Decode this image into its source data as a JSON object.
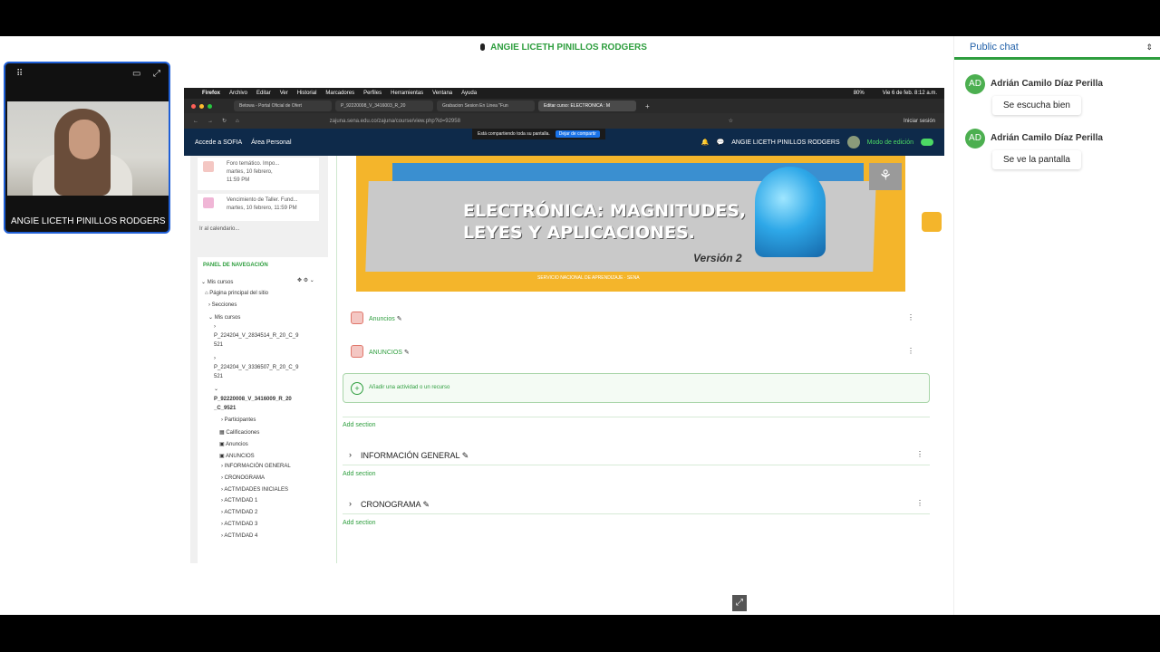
{
  "speaker": {
    "name": "ANGIE LICETH PINILLOS RODGERS"
  },
  "webcam": {
    "name": "ANGIE LICETH PINILLOS RODGERS"
  },
  "browser": {
    "menu": [
      "Firefox",
      "Archivo",
      "Editar",
      "Ver",
      "Historial",
      "Marcadores",
      "Perfiles",
      "Herramientas",
      "Ventana",
      "Ayuda"
    ],
    "clock": "Vie 6 de feb. 8:12 a.m.",
    "battery": "80%",
    "tabs": [
      "Betowa - Portal Oficial de Ofert",
      "P_92220008_V_3416003_R_20",
      "Grabacion Sesion En Linea \"Fun",
      "Editar curso: ELECTRONICA : M"
    ],
    "url": "zajuna.sena.edu.co/zajuna/course/view.php?id=92958",
    "login": "Iniciar sesión",
    "share_text": "Está compartiendo toda su pantalla.",
    "share_stop": "Dejar de compartir"
  },
  "sena": {
    "nav": [
      "Accede a SOFIA",
      "Área Personal"
    ],
    "user": "ANGIE LICETH PINILLOS RODGERS",
    "mode": "Modo de edición"
  },
  "events": [
    {
      "title": "Foro temático. Impo...",
      "date": "martes, 10 febrero,",
      "time": "11:59 PM"
    },
    {
      "title": "Vencimiento de Taller. Fund...",
      "date": "martes, 10 febrero, 11:59 PM"
    }
  ],
  "calendar_link": "Ir al calendario...",
  "nav_panel": {
    "title": "PANEL DE NAVEGACIÓN",
    "lines": [
      "Mis cursos",
      "Página principal del sitio",
      "Secciones",
      "Mis cursos",
      "P_224204_V_2834514_R_20_C_9",
      "521",
      "P_224204_V_3336507_R_20_C_9",
      "521",
      "P_92220008_V_3416009_R_20",
      "_C_9521",
      "Participantes",
      "Calificaciones",
      "Anuncios",
      "ANUNCIOS",
      "INFORMACIÓN GENERAL",
      "CRONOGRAMA",
      "ACTIVIDADES INICIALES",
      "ACTIVIDAD 1",
      "ACTIVIDAD 2",
      "ACTIVIDAD 3",
      "ACTIVIDAD 4"
    ]
  },
  "banner": {
    "line1": "ELECTRÓNICA: MAGNITUDES,",
    "line2": "LEYES Y APLICACIONES.",
    "version": "Versión 2",
    "footer": "SERVICIO NACIONAL DE APRENDIZAJE · SENA"
  },
  "course": {
    "anuncios1": "Anuncios",
    "anuncios2": "ANUNCIOS",
    "add_activity": "Añadir una actividad o un recurso",
    "add_section": "Add section",
    "sections": [
      "INFORMACIÓN GENERAL",
      "CRONOGRAMA"
    ]
  },
  "chat": {
    "title": "Public chat",
    "messages": [
      {
        "initials": "AD",
        "author": "Adrián Camilo Díaz Perilla",
        "text": "Se escucha bien"
      },
      {
        "initials": "AD",
        "author": "Adrián Camilo Díaz Perilla",
        "text": "Se ve la pantalla"
      }
    ]
  },
  "colors": {
    "accent": "#2e9e3e",
    "sena_nav": "#0e2a4a",
    "banner_yellow": "#f4b52b",
    "cam_border": "#1f5fd6"
  }
}
